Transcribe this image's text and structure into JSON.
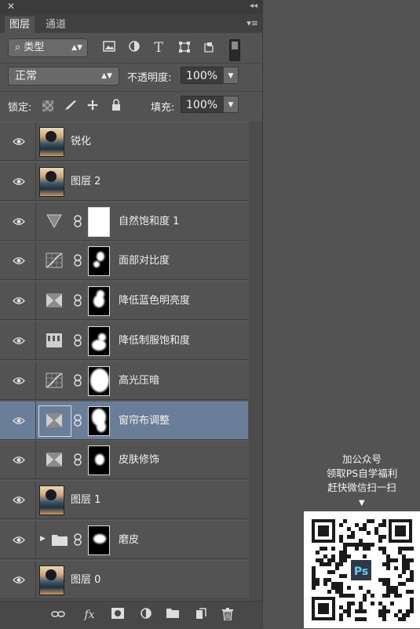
{
  "panel": {
    "close_glyph": "✕",
    "collapse_glyph": "◂◂",
    "tabs": [
      "图层",
      "通道"
    ],
    "menu_glyph": "▾≡"
  },
  "filter": {
    "kind_label": "类型",
    "icons": [
      "image-filter-icon",
      "adjustment-filter-icon",
      "type-filter-icon",
      "shape-filter-icon",
      "smart-object-filter-icon"
    ]
  },
  "blend": {
    "mode": "正常",
    "opacity_label": "不透明度:",
    "opacity_value": "100%"
  },
  "lock": {
    "label": "锁定:",
    "fill_label": "填充:",
    "fill_value": "100%"
  },
  "layers": [
    {
      "name": "锐化",
      "kind": "photo"
    },
    {
      "name": "图层 2",
      "kind": "photo"
    },
    {
      "name": "自然饱和度 1",
      "kind": "vibrance",
      "mask": "white"
    },
    {
      "name": "面部对比度",
      "kind": "curves",
      "mask": "m1"
    },
    {
      "name": "降低蓝色明亮度",
      "kind": "hsl",
      "mask": "m2"
    },
    {
      "name": "降低制服饱和度",
      "kind": "huesat",
      "mask": "m3"
    },
    {
      "name": "高光压暗",
      "kind": "curves",
      "mask": "m4"
    },
    {
      "name": "窗帘布调整",
      "kind": "hsl",
      "mask": "m5",
      "selected": true
    },
    {
      "name": "皮肤修饰",
      "kind": "hsl",
      "mask": "m6"
    },
    {
      "name": "图层 1",
      "kind": "photo"
    },
    {
      "name": "磨皮",
      "kind": "group",
      "mask": "m7"
    },
    {
      "name": "图层 0",
      "kind": "photo"
    }
  ],
  "bottom_icons": [
    "link-layers-icon",
    "fx-icon",
    "add-mask-icon",
    "new-adjustment-icon",
    "new-group-icon",
    "new-layer-icon",
    "trash-icon"
  ],
  "bottom_fx": "fx",
  "promo": {
    "line1": "加公众号",
    "line2": "领取PS自学福利",
    "line3": "赶快微信扫一扫",
    "arrow": "▼",
    "qr_badge": "Ps"
  }
}
